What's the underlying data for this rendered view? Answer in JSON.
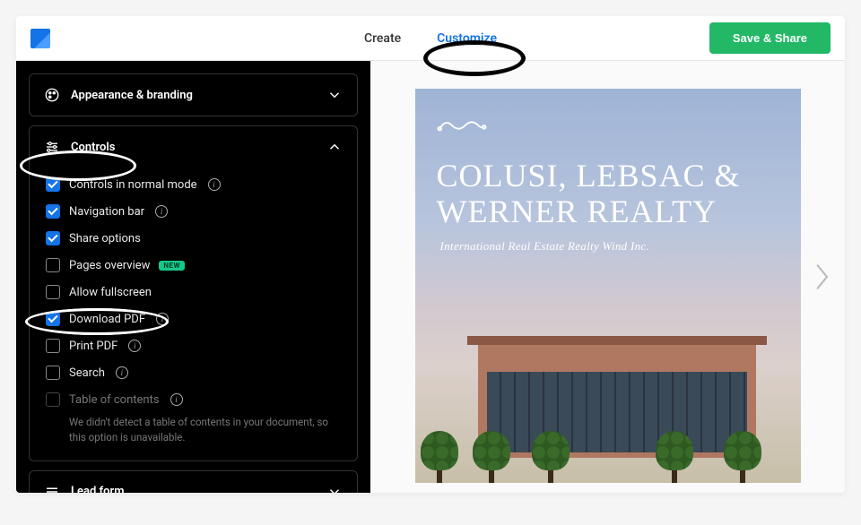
{
  "topbar": {
    "tabs": {
      "create": "Create",
      "customize": "Customize"
    },
    "save_share": "Save & Share"
  },
  "sidebar": {
    "sections": {
      "appearance": "Appearance & branding",
      "controls": "Controls",
      "lead_form": "Lead form"
    },
    "controls": {
      "normal_mode": "Controls in normal mode",
      "nav_bar": "Navigation bar",
      "share": "Share options",
      "pages_overview": "Pages overview",
      "pages_badge": "NEW",
      "fullscreen": "Allow fullscreen",
      "download_pdf": "Download PDF",
      "print_pdf": "Print PDF",
      "search": "Search",
      "toc": "Table of contents",
      "toc_note": "We didn't detect a table of contents in your document, so this option is unavailable."
    }
  },
  "document": {
    "title": "COLUSI, LEBSAC & WERNER REALTY",
    "subtitle": "International Real Estate Realty Wind Inc."
  }
}
